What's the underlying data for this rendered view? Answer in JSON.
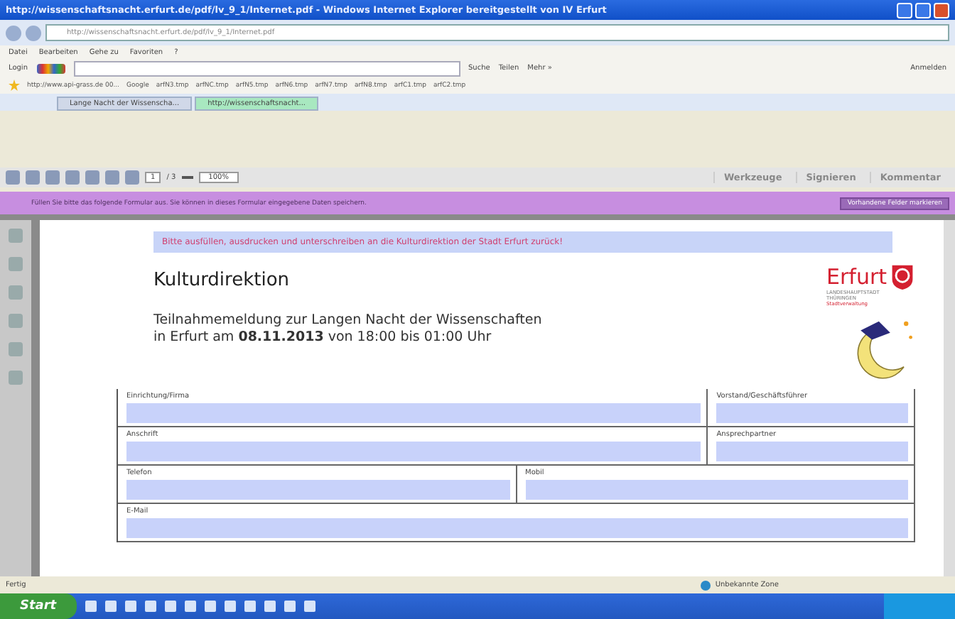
{
  "window": {
    "title": "http://wissenschaftsnacht.erfurt.de/pdf/lv_9_1/Internet.pdf - Windows Internet Explorer bereitgestellt von IV Erfurt"
  },
  "address_bar": {
    "value": "http://wissenschaftsnacht.erfurt.de/pdf/lv_9_1/Internet.pdf"
  },
  "menu": [
    "Datei",
    "Bearbeiten",
    "Gehe zu",
    "Favoriten",
    "?"
  ],
  "google_bar": {
    "login": "Login",
    "search_label": "Suche",
    "share": "Teilen",
    "more": "Mehr »",
    "signin": "Anmelden"
  },
  "favorites": [
    "http://www.api-grass.de 00...",
    "Google",
    "arfN3.tmp",
    "arfNC.tmp",
    "arfN5.tmp",
    "arfN6.tmp",
    "arfN7.tmp",
    "arfN8.tmp",
    "arfC1.tmp",
    "arfC2.tmp"
  ],
  "tabs": [
    {
      "label": "Lange Nacht der Wissenscha...",
      "selected": false
    },
    {
      "label": "http://wissenschaftsnacht...",
      "selected": true
    }
  ],
  "pdf_toolbar": {
    "page": "1",
    "page_count": "/ 3",
    "zoom": "100%",
    "panels": [
      "Werkzeuge",
      "Signieren",
      "Kommentar"
    ]
  },
  "form_bar": {
    "message": "Füllen Sie bitte das folgende Formular aus. Sie können in dieses Formular eingegebene Daten speichern.",
    "button": "Vorhandene Felder markieren"
  },
  "document": {
    "notice": "Bitte ausfüllen, ausdrucken und unterschreiben an die Kulturdirektion der Stadt Erfurt zurück!",
    "department": "Kulturdirektion",
    "logo": {
      "name": "Erfurt",
      "line1": "LANDESHAUPTSTADT",
      "line2": "THÜRINGEN",
      "line3": "Stadtverwaltung"
    },
    "heading": "Teilnahmemeldung zur Langen Nacht der Wissenschaften",
    "subheading": "in Erfurt am **08.11.2013**   von 18:00 bis 01:00 Uhr",
    "form_rows": [
      {
        "fields": [
          {
            "label": "Einrichtung/Firma"
          },
          {
            "label": "Vorstand/Geschäftsführer"
          }
        ]
      },
      {
        "fields": [
          {
            "label": "Anschrift"
          },
          {
            "label": "Ansprechpartner"
          }
        ]
      },
      {
        "fields": [
          {
            "label": "Telefon"
          },
          {
            "label": "Mobil"
          }
        ]
      },
      {
        "fields": [
          {
            "label": "E-Mail"
          }
        ]
      }
    ]
  },
  "status_bar": {
    "text": "Fertig",
    "zone": "Unbekannte Zone"
  },
  "taskbar": {
    "start": "Start"
  }
}
